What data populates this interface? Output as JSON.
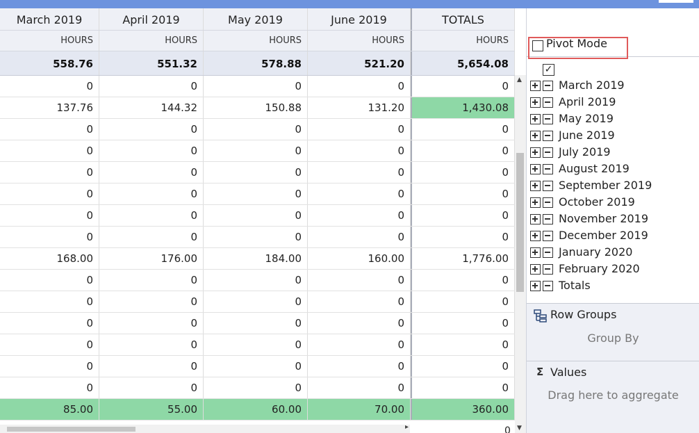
{
  "grid": {
    "columns": [
      {
        "label": "March 2019",
        "sub": "HOURS",
        "total": "558.76"
      },
      {
        "label": "April 2019",
        "sub": "HOURS",
        "total": "551.32"
      },
      {
        "label": "May 2019",
        "sub": "HOURS",
        "total": "578.88"
      },
      {
        "label": "June 2019",
        "sub": "HOURS",
        "total": "521.20"
      },
      {
        "label": "TOTALS",
        "sub": "HOURS",
        "total": "5,654.08"
      }
    ],
    "rows": [
      [
        "0",
        "0",
        "0",
        "0",
        "0"
      ],
      [
        "137.76",
        "144.32",
        "150.88",
        "131.20",
        "1,430.08"
      ],
      [
        "0",
        "0",
        "0",
        "0",
        "0"
      ],
      [
        "0",
        "0",
        "0",
        "0",
        "0"
      ],
      [
        "0",
        "0",
        "0",
        "0",
        "0"
      ],
      [
        "0",
        "0",
        "0",
        "0",
        "0"
      ],
      [
        "0",
        "0",
        "0",
        "0",
        "0"
      ],
      [
        "0",
        "0",
        "0",
        "0",
        "0"
      ],
      [
        "168.00",
        "176.00",
        "184.00",
        "160.00",
        "1,776.00"
      ],
      [
        "0",
        "0",
        "0",
        "0",
        "0"
      ],
      [
        "0",
        "0",
        "0",
        "0",
        "0"
      ],
      [
        "0",
        "0",
        "0",
        "0",
        "0"
      ],
      [
        "0",
        "0",
        "0",
        "0",
        "0"
      ],
      [
        "0",
        "0",
        "0",
        "0",
        "0"
      ],
      [
        "0",
        "0",
        "0",
        "0",
        "0"
      ],
      [
        "85.00",
        "55.00",
        "60.00",
        "70.00",
        "360.00"
      ]
    ],
    "partial_bottom_value": "0",
    "highlight_color": "#8ed8a6"
  },
  "panel": {
    "pivot_mode_label": "Pivot Mode",
    "select_all_check": "✓",
    "columns": [
      "March 2019",
      "April 2019",
      "May 2019",
      "June 2019",
      "July 2019",
      "August 2019",
      "September 2019",
      "October 2019",
      "November 2019",
      "December 2019",
      "January 2020",
      "February 2020",
      "Totals"
    ],
    "row_groups_title": "Row Groups",
    "row_groups_hint": "Group By",
    "values_title": "Values",
    "values_hint": "Drag here to aggregate",
    "values_icon": "Σ"
  }
}
